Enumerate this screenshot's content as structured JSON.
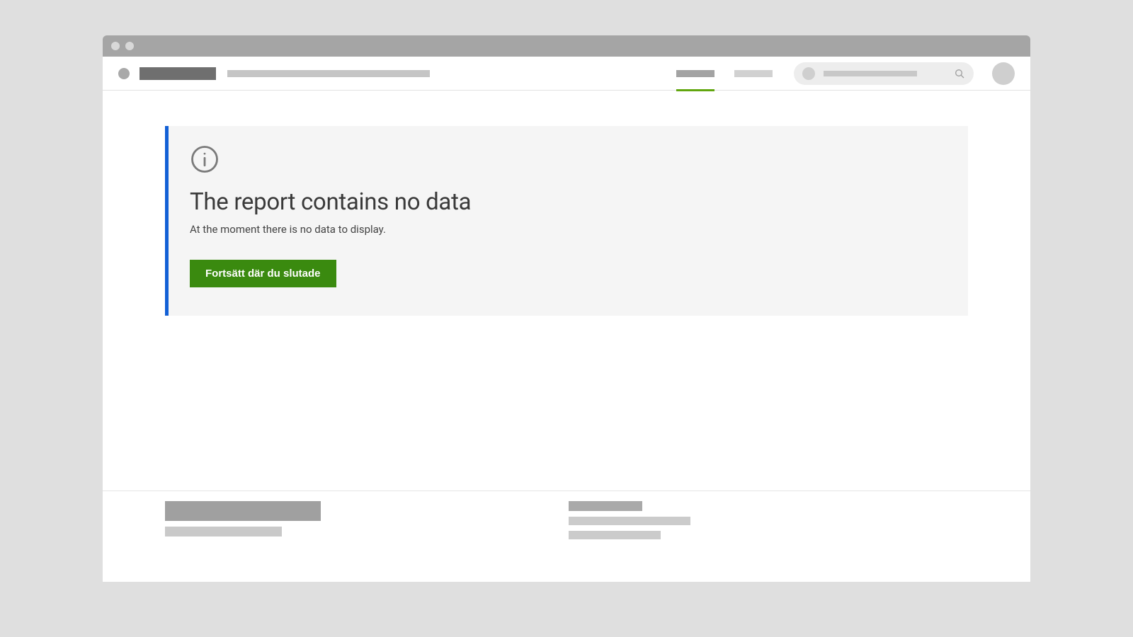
{
  "info_panel": {
    "title": "The report contains no data",
    "subtitle": "At the moment there is no data to display.",
    "button_label": "Fortsätt där du slutade"
  }
}
